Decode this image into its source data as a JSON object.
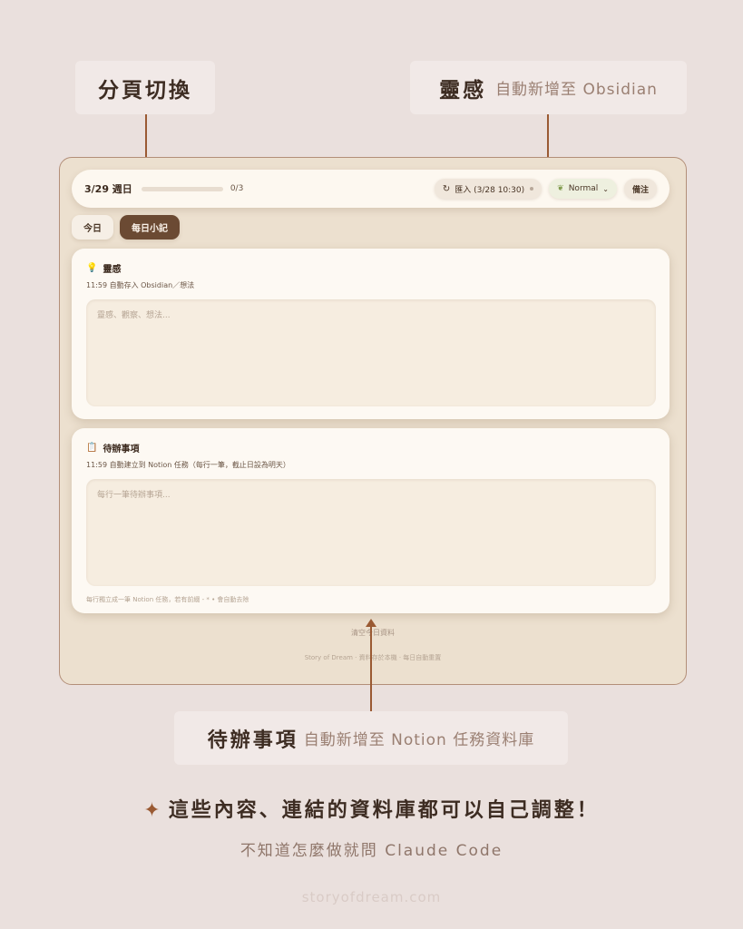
{
  "callouts": {
    "tabs": {
      "main": "分頁切換"
    },
    "inspiration": {
      "main": "靈感",
      "sub": "自動新增至 Obsidian"
    },
    "todo": {
      "main": "待辦事項",
      "sub": "自動新增至 Notion 任務資料庫"
    }
  },
  "app": {
    "topbar": {
      "week": "3/29 週日",
      "progress": {
        "count": "0/3",
        "fraction": 0
      },
      "import_label": "匯入 (3/28 10:30)",
      "mode_label": "Normal",
      "note_label": "備注"
    },
    "tabs": [
      {
        "label": "今日",
        "active": false
      },
      {
        "label": "每日小記",
        "active": true
      }
    ],
    "inspiration_card": {
      "icon": "lightbulb-icon",
      "title": "靈感",
      "subtitle": "11:59 自動存入 Obsidian／想法",
      "placeholder": "靈感、觀察、想法..."
    },
    "todo_card": {
      "icon": "memo-icon",
      "title": "待辦事項",
      "subtitle": "11:59 自動建立到 Notion 任務（每行一筆，截止日設為明天）",
      "placeholder": "每行一筆待辦事項...",
      "footer": "每行獨立成一筆 Notion 任務，若有前綴 - * • 會自動去除"
    },
    "clear_label": "清空今日資料",
    "footer_note": "Story of Dream · 資料存於本機 · 每日自動重置"
  },
  "headline": "這些內容、連結的資料庫都可以自己調整！",
  "subline": "不知道怎麼做就問 Claude Code",
  "brand": "storyofdream.com",
  "colors": {
    "background": "#eae0dd",
    "accent": "#9a5a33",
    "active_tab": "#6b4a33",
    "card": "#fdf9f3"
  }
}
